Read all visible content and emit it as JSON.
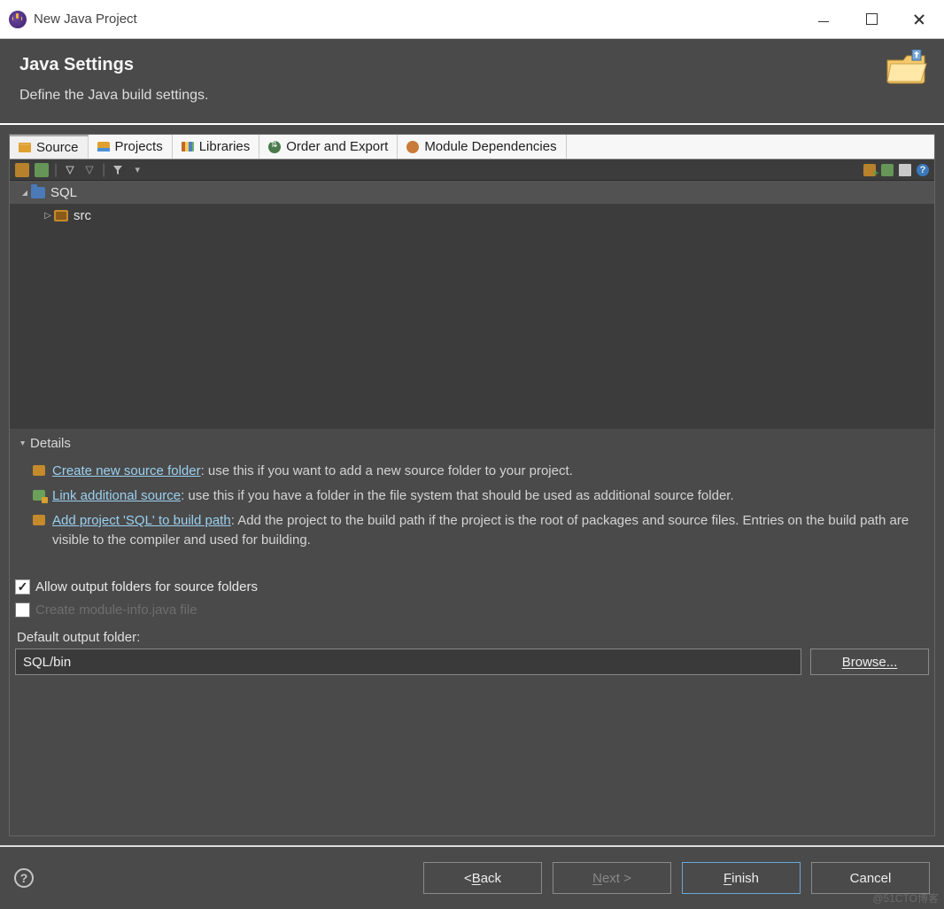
{
  "window": {
    "title": "New Java Project"
  },
  "header": {
    "title": "Java Settings",
    "subtitle": "Define the Java build settings."
  },
  "tabs": {
    "source": "Source",
    "projects": "Projects",
    "libraries": "Libraries",
    "order": "Order and Export",
    "module": "Module Dependencies"
  },
  "tree": {
    "root": "SQL",
    "child": "src"
  },
  "details": {
    "heading": "Details",
    "item1_link": "Create new source folder",
    "item1_text": ": use this if you want to add a new source folder to your project.",
    "item2_link": "Link additional source",
    "item2_text": ": use this if you have a folder in the file system that should be used as additional source folder.",
    "item3_link": "Add project 'SQL' to build path",
    "item3_text": ": Add the project to the build path if the project is the root of packages and source files. Entries on the build path are visible to the compiler and used for building."
  },
  "options": {
    "allow_output": "Allow output folders for source folders",
    "allow_output_checked": true,
    "create_moduleinfo": "Create module-info.java file",
    "create_moduleinfo_checked": false,
    "output_label": "Default output folder:",
    "output_value": "SQL/bin",
    "browse": "Browse..."
  },
  "buttons": {
    "back_prefix": "< ",
    "back_letter": "B",
    "back_rest": "ack",
    "next_letter": "N",
    "next_rest": "ext >",
    "finish_letter": "F",
    "finish_rest": "inish",
    "cancel": "Cancel"
  },
  "watermark": "@51CTO博客"
}
